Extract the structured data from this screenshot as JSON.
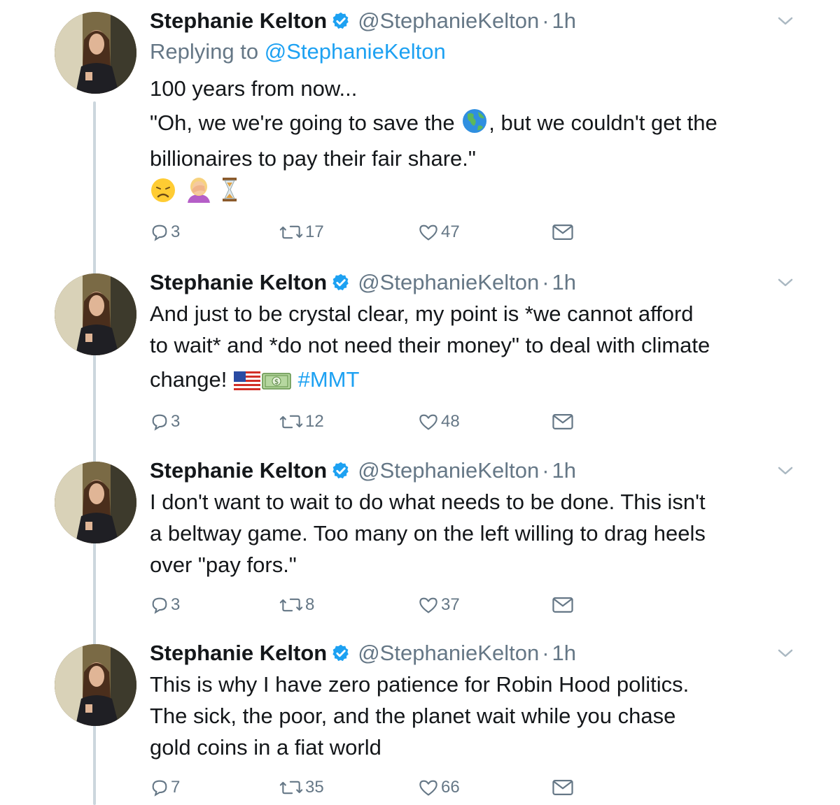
{
  "tweets": [
    {
      "author_name": "Stephanie Kelton",
      "handle": "@StephanieKelton",
      "separator": "·",
      "time": "1h",
      "reply_prefix": "Replying to",
      "reply_to": "@StephanieKelton",
      "line1": "100 years from now...",
      "line2a": "\"Oh, we we're going to save the",
      "emoji_earth": "🌎",
      "line2b": ", but we couldn't get the",
      "line3": "billionaires to pay their fair share.\"",
      "emoji_line": [
        "😞",
        "🤦‍♀️",
        "⏳"
      ],
      "replies": "3",
      "retweets": "17",
      "likes": "47"
    },
    {
      "author_name": "Stephanie Kelton",
      "handle": "@StephanieKelton",
      "separator": "·",
      "time": "1h",
      "line1": "And just to be crystal clear, my point is *we cannot afford",
      "line2": "to wait* and *do not need their money\" to deal with climate",
      "line3": "change!",
      "emoji_flag": "🇺🇸",
      "emoji_money": "💵",
      "hashtag": "#MMT",
      "replies": "3",
      "retweets": "12",
      "likes": "48"
    },
    {
      "author_name": "Stephanie Kelton",
      "handle": "@StephanieKelton",
      "separator": "·",
      "time": "1h",
      "line1": "I don't want to wait to do what needs to be done. This isn't",
      "line2": "a beltway game. Too many on the left willing to drag heels",
      "line3": "over \"pay fors.\"",
      "replies": "3",
      "retweets": "8",
      "likes": "37"
    },
    {
      "author_name": "Stephanie Kelton",
      "handle": "@StephanieKelton",
      "separator": "·",
      "time": "1h",
      "line1": "This is why I have zero patience for Robin Hood politics.",
      "line2": "The sick, the poor, and the planet wait while you chase",
      "line3": "gold coins in a fiat world",
      "replies": "7",
      "retweets": "35",
      "likes": "66"
    }
  ],
  "colors": {
    "link": "#1da1f2",
    "secondary_text": "#657786",
    "thread_line": "#ccd6dd",
    "verified_badge": "#1da1f2"
  },
  "icons": [
    "verified-badge-icon",
    "caret-down-icon",
    "reply-icon",
    "retweet-icon",
    "like-icon",
    "direct-message-icon",
    "earth-emoji-icon",
    "disappointed-face-emoji-icon",
    "facepalm-emoji-icon",
    "hourglass-emoji-icon",
    "us-flag-emoji-icon",
    "money-emoji-icon"
  ]
}
